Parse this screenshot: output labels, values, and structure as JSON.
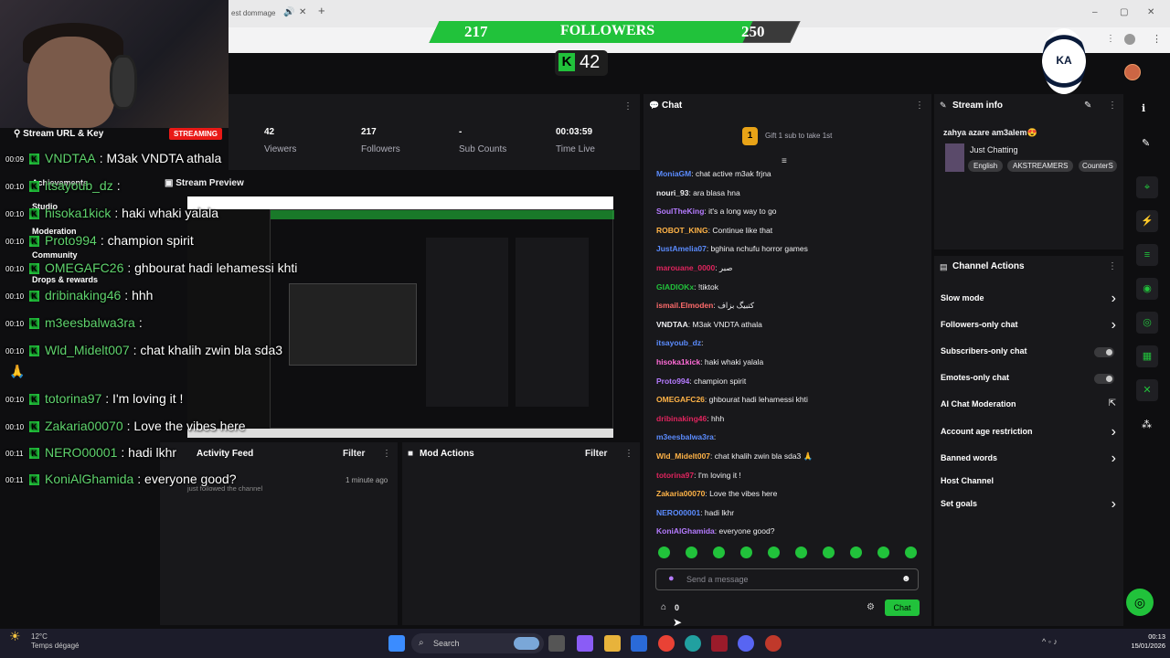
{
  "browser": {
    "tab_title": "est dommage",
    "tab_icon": "speaker-icon",
    "close": "✕",
    "new_tab": "+"
  },
  "followers": {
    "current": "217",
    "label": "FOLLOWERS",
    "goal": "250",
    "progress": 0.868
  },
  "viewer_badge": {
    "value": "42"
  },
  "logo_text": "KA",
  "stats": [
    {
      "value": "42",
      "label": "Viewers"
    },
    {
      "value": "217",
      "label": "Followers"
    },
    {
      "value": "-",
      "label": "Sub Counts"
    },
    {
      "value": "00:03:59",
      "label": "Time Live"
    }
  ],
  "left_nav": {
    "stream_url": "Stream URL & Key",
    "streaming_badge": "STREAMING",
    "items": [
      "Achievements",
      "Studio",
      "Moderation",
      "Community",
      "Drops & rewards"
    ],
    "stream_preview": "Stream Preview"
  },
  "overlay_chat": [
    {
      "ts": "00:09",
      "user": "VNDTAA",
      "text": ": M3ak VNDTA athala"
    },
    {
      "ts": "00:10",
      "user": "itsayoub_dz",
      "text": ":"
    },
    {
      "ts": "00:10",
      "user": "hisoka1kick",
      "text": ": haki whaki yalala"
    },
    {
      "ts": "00:10",
      "user": "Proto994",
      "text": ": champion spirit"
    },
    {
      "ts": "00:10",
      "user": "OMEGAFC26",
      "text": ": ghbourat hadi lehamessi khti"
    },
    {
      "ts": "00:10",
      "user": "dribinaking46",
      "text": ": hhh"
    },
    {
      "ts": "00:10",
      "user": "m3eesbalwa3ra",
      "text": ":"
    },
    {
      "ts": "00:10",
      "user": "Wld_Midelt007",
      "text": ": chat khalih zwin bla sda3"
    },
    {
      "ts": "00:10",
      "user": "totorina97",
      "text": ": I'm loving it !"
    },
    {
      "ts": "00:10",
      "user": "Zakaria00070",
      "text": ": Love the vibes here"
    },
    {
      "ts": "00:11",
      "user": "NERO00001",
      "text": ": hadi lkhr"
    },
    {
      "ts": "00:11",
      "user": "KoniAlGhamida",
      "text": ": everyone good?"
    }
  ],
  "activity_feed": {
    "title": "Activity Feed",
    "filter": "Filter",
    "time": "1 minute ago",
    "event": "just followed the channel"
  },
  "mod_actions": {
    "title": "Mod Actions",
    "filter": "Filter"
  },
  "chat": {
    "title": "Chat",
    "gift_badge": "1",
    "gift_text": "Gift 1 sub to take 1st",
    "messages": [
      {
        "user": "MoniaGM",
        "text": ": chat active m3ak frjna",
        "color": "#5b8cff"
      },
      {
        "user": "nouri_93",
        "text": ": ara blasa hna",
        "color": "#efeff1"
      },
      {
        "user": "SoulTheKing",
        "text": ": it's a long way to go",
        "color": "#b57bff"
      },
      {
        "user": "ROBOT_KING",
        "text": ": Continue like that",
        "color": "#ffb347"
      },
      {
        "user": "JustAmelia07",
        "text": ": bghina nchufu horror games",
        "color": "#5b8cff"
      },
      {
        "user": "marouane_0000",
        "text": ": صبر",
        "color": "#e0245e"
      },
      {
        "user": "GIADIOKx",
        "text": ": !tiktok",
        "color": "#21c23b"
      },
      {
        "user": "ismail.Elmoden",
        "text": ": كتبيگ بزاف",
        "color": "#ff6b6b"
      },
      {
        "user": "VNDTAA",
        "text": ": M3ak VNDTA athala",
        "color": "#efeff1"
      },
      {
        "user": "itsayoub_dz",
        "text": ":",
        "color": "#5b8cff"
      },
      {
        "user": "hisoka1kick",
        "text": ": haki whaki yalala",
        "color": "#ff6bd6"
      },
      {
        "user": "Proto994",
        "text": ": champion spirit",
        "color": "#b57bff"
      },
      {
        "user": "OMEGAFC26",
        "text": ": ghbourat hadi lehamessi khti",
        "color": "#ffb347"
      },
      {
        "user": "dribinaking46",
        "text": ": hhh",
        "color": "#e0245e"
      },
      {
        "user": "m3eesbalwa3ra",
        "text": ":",
        "color": "#5b8cff"
      },
      {
        "user": "Wld_Midelt007",
        "text": ": chat khalih zwin bla sda3 🙏",
        "color": "#ffb347"
      },
      {
        "user": "totorina97",
        "text": ": I'm loving it !",
        "color": "#e0245e"
      },
      {
        "user": "Zakaria00070",
        "text": ": Love the vibes here",
        "color": "#ffb347"
      },
      {
        "user": "NERO00001",
        "text": ": hadi lkhr",
        "color": "#5b8cff"
      },
      {
        "user": "KoniAlGhamida",
        "text": ": everyone good?",
        "color": "#b57bff"
      }
    ],
    "placeholder": "Send a message",
    "points": "0",
    "send_label": "Chat"
  },
  "stream_info": {
    "title": "Stream info",
    "stream_title": "zahya azare am3alem😍",
    "category": "Just Chatting",
    "tags": [
      "English",
      "AKSTREAMERS",
      "CounterS"
    ]
  },
  "channel_actions": {
    "title": "Channel Actions",
    "items": [
      {
        "label": "Slow mode",
        "control": "chevron"
      },
      {
        "label": "Followers-only chat",
        "control": "chevron"
      },
      {
        "label": "Subscribers-only chat",
        "control": "toggle"
      },
      {
        "label": "Emotes-only chat",
        "control": "toggle"
      },
      {
        "label": "AI Chat Moderation",
        "control": "external"
      },
      {
        "label": "Account age restriction",
        "control": "chevron"
      },
      {
        "label": "Banned words",
        "control": "chevron"
      },
      {
        "label": "Host Channel",
        "control": "none"
      },
      {
        "label": "Set goals",
        "control": "chevron"
      }
    ]
  },
  "taskbar": {
    "weather_temp": "12°C",
    "weather_desc": "Temps dégagé",
    "search": "Search",
    "time": "00:13",
    "date": "15/01/2026"
  },
  "colors": {
    "accent": "#21c23b",
    "panel": "#18181b",
    "bg": "#0e0e10",
    "live": "#e91916"
  }
}
